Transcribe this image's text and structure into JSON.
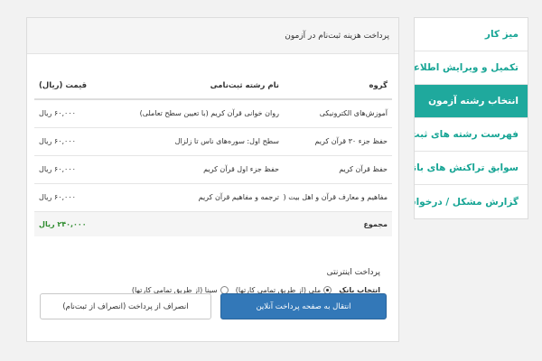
{
  "sidebar": {
    "items": [
      {
        "label": "میز کار"
      },
      {
        "label": "تکمیل و ویرایش اطلاعات"
      },
      {
        "label": "انتخاب رشته آزمون"
      },
      {
        "label": "فهرست رشته های ثبت نامی"
      },
      {
        "label": "سوابق تراکنش های بانکی"
      },
      {
        "label": "گزارش مشکل / درخواست"
      }
    ],
    "active_index": 2
  },
  "panel": {
    "title": "پرداخت هزینه ثبت‌نام در آزمون"
  },
  "table": {
    "headers": [
      "گروه",
      "نام رشته ثبت‌نامی",
      "قیمت (ریال)"
    ],
    "rows": [
      [
        "آموزش‌های الکترونیکی",
        "روان خوانی قرآن کریم (با تعیین سطح تعاملی)",
        "۶۰,۰۰۰ ریال"
      ],
      [
        "حفظ جزء ۳۰ قرآن کریم",
        "سطح اول: سوره‌های ناس تا زلزال",
        "۶۰,۰۰۰ ریال"
      ],
      [
        "حفظ قرآن کریم",
        "حفظ جزء اول قرآن کریم",
        "۶۰,۰۰۰ ریال"
      ],
      [
        "مفاهیم و معارف قرآن و اهل بیت (علیهم السلام)",
        "ترجمه و مفاهیم قرآن کریم",
        "۶۰,۰۰۰ ریال"
      ]
    ],
    "total_label": "مجموع",
    "total_value": "۲۴۰,۰۰۰ ریال"
  },
  "payment": {
    "title": "پرداخت اینترنتی",
    "bank_label": "انتخاب بانک",
    "options": [
      "ملی (از طریق تمامی کارتها)",
      "سینا (از طریق تمامی کارتها)"
    ],
    "selected_index": 0
  },
  "buttons": {
    "pay": "انتقال به صفحه پرداخت آنلاین",
    "cancel": "انصراف از پرداخت (انصراف از ثبت‌نام)"
  },
  "colors": {
    "accent": "#1fa99d",
    "primary_button": "#3378b8",
    "total": "#2e8b2e"
  }
}
